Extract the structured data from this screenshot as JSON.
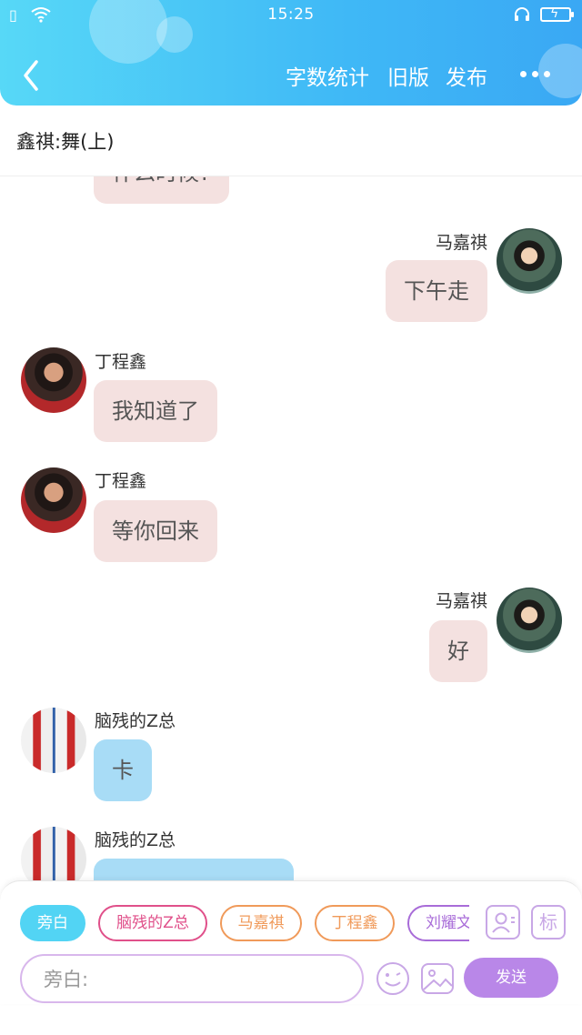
{
  "status_bar": {
    "time": "15:25"
  },
  "nav": {
    "back_icon": "chevron-left-icon",
    "word_count": "字数统计",
    "old_version": "旧版",
    "publish": "发布",
    "more_icon": "more-dots-icon"
  },
  "title": "鑫祺:舞(上)",
  "messages": [
    {
      "side": "left",
      "sender": "",
      "text": "什么时候?",
      "color": "pink"
    },
    {
      "side": "right",
      "sender": "马嘉祺",
      "text": "下午走",
      "color": "pink"
    },
    {
      "side": "left",
      "sender": "丁程鑫",
      "text": "我知道了",
      "color": "pink"
    },
    {
      "side": "left",
      "sender": "丁程鑫",
      "text": "等你回来",
      "color": "pink"
    },
    {
      "side": "right",
      "sender": "马嘉祺",
      "text": "好",
      "color": "pink"
    },
    {
      "side": "left",
      "sender": "脑残的Z总",
      "text": "卡",
      "color": "blue"
    },
    {
      "side": "left",
      "sender": "脑残的Z总",
      "text": "",
      "color": "blue"
    }
  ],
  "roles": [
    {
      "label": "旁白",
      "color": "#52d4f4"
    },
    {
      "label": "脑残的Z总",
      "color": "#e0508a"
    },
    {
      "label": "马嘉祺",
      "color": "#f09a5a"
    },
    {
      "label": "丁程鑫",
      "color": "#f09a5a"
    },
    {
      "label": "刘耀文",
      "color": "#a86cd8"
    }
  ],
  "tools": {
    "add_role_icon": "contact-card-icon",
    "tag_label": "标"
  },
  "input": {
    "placeholder": "旁白:"
  },
  "send_label": "发送",
  "colors": {
    "header_start": "#57d8f7",
    "header_end": "#3aa8f4",
    "accent_purple": "#b987e8"
  }
}
